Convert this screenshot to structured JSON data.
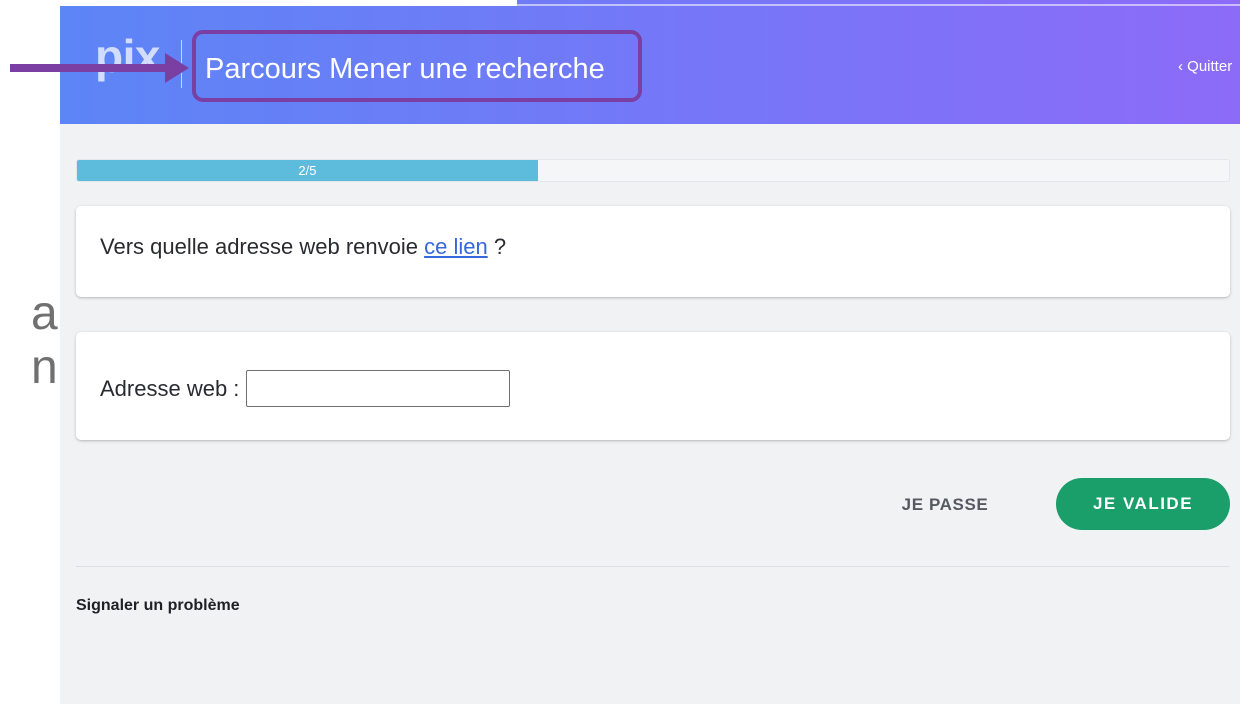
{
  "slide": {
    "fragments": [
      "a",
      "n"
    ]
  },
  "header": {
    "logo": "pix",
    "title": "Parcours Mener une recherche",
    "quit_icon": "‹",
    "quit_label": "Quitter"
  },
  "progress": {
    "label": "2/5",
    "current": 2,
    "total": 5
  },
  "question": {
    "prefix": "Vers quelle adresse web renvoie",
    "link_text": "ce lien",
    "suffix": "?"
  },
  "answer": {
    "label": "Adresse web :",
    "input_value": ""
  },
  "actions": {
    "skip_label": "JE PASSE",
    "validate_label": "JE VALIDE"
  },
  "footer": {
    "report_label": "Signaler un problème"
  },
  "icons": {
    "quit": "chevron-left-icon",
    "annotation": "arrow-right-icon"
  },
  "colors": {
    "header_start": "#5c85f6",
    "header_end": "#8c6bf9",
    "progress_fill": "#5dbcdc",
    "validate_button": "#1a9f6b",
    "link": "#3767dc",
    "annotation": "#7b3fa3"
  }
}
